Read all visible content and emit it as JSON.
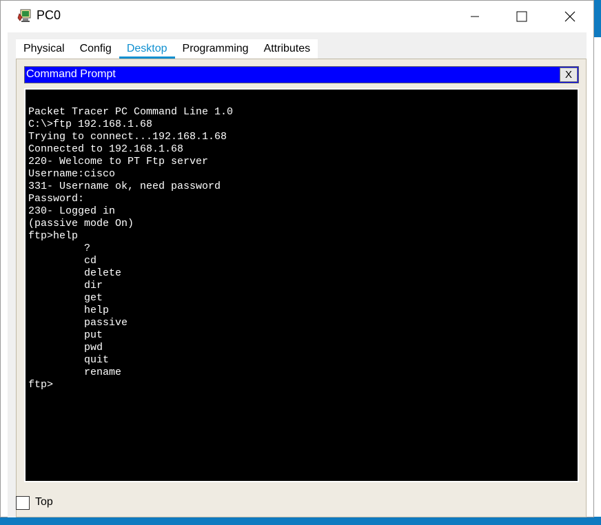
{
  "window": {
    "title": "PC0",
    "controls": [
      "minimize-icon",
      "maximize-icon",
      "close-icon"
    ]
  },
  "tabs": [
    {
      "label": "Physical",
      "active": false
    },
    {
      "label": "Config",
      "active": false
    },
    {
      "label": "Desktop",
      "active": true
    },
    {
      "label": "Programming",
      "active": false
    },
    {
      "label": "Attributes",
      "active": false
    }
  ],
  "command_prompt": {
    "title": "Command Prompt",
    "close_label": "X",
    "lines": [
      "Packet Tracer PC Command Line 1.0",
      "C:\\>ftp 192.168.1.68",
      "Trying to connect...192.168.1.68",
      "Connected to 192.168.1.68",
      "220- Welcome to PT Ftp server",
      "Username:cisco",
      "331- Username ok, need password",
      "Password:",
      "230- Logged in",
      "(passive mode On)",
      "ftp>help",
      "         ?",
      "         cd",
      "         delete",
      "         dir",
      "         get",
      "         help",
      "         passive",
      "         put",
      "         pwd",
      "         quit",
      "         rename",
      "ftp>"
    ]
  },
  "footer": {
    "top_label": "Top",
    "top_checked": false
  },
  "colors": {
    "accent": "#0e8fd0",
    "prompt_header": "#0000ff",
    "terminal_bg": "#000000",
    "terminal_text": "#ffffff",
    "desktop": "#0f7ac0"
  }
}
